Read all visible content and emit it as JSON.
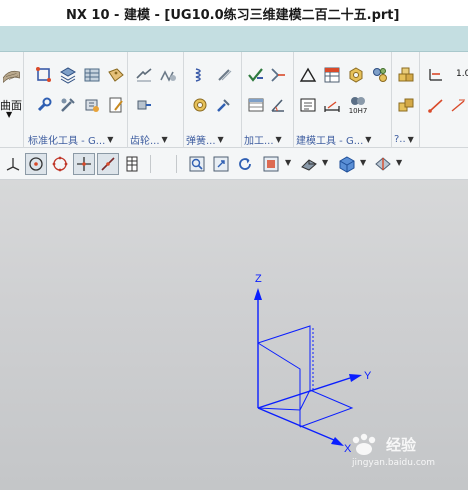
{
  "window": {
    "title": "NX 10 - 建模 - [UG10.0练习三维建模二百二十五.prt]"
  },
  "ribbon": {
    "left_partial_label": "曲面",
    "groups": [
      {
        "label": "标准化工具 - G..."
      },
      {
        "label": "齿轮..."
      },
      {
        "label": "弹簧..."
      },
      {
        "label": "加工..."
      },
      {
        "label": "建模工具 - G..."
      },
      {
        "label": "?.."
      }
    ],
    "fit_code": "10H7",
    "partial_right_text": "1.0"
  },
  "canvas": {
    "axes": {
      "z_label": "Z",
      "y_label": "Y",
      "x_label": "X"
    }
  },
  "watermark": {
    "brand": "经验",
    "site": "jingyan.baidu.com"
  },
  "colors": {
    "axis_blue": "#0a1eff",
    "tab_strip": "#c4dee1",
    "viewport_bg": "#cfd0d2",
    "group_label": "#3f5ea0"
  }
}
